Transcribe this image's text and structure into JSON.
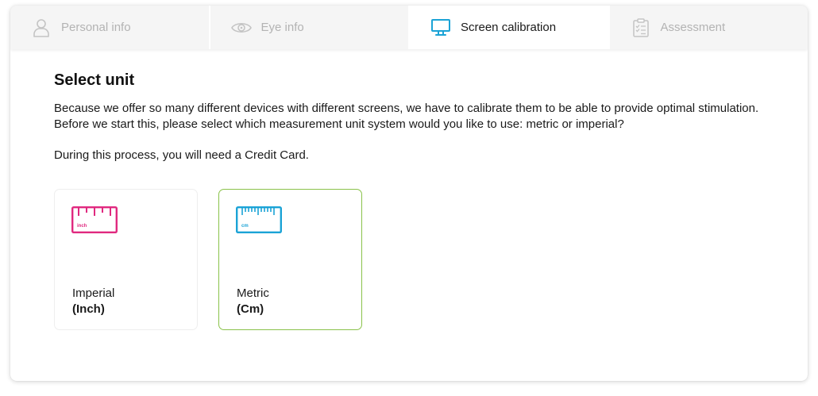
{
  "steps": [
    {
      "label": "Personal info",
      "icon": "person-icon",
      "state": "inactive"
    },
    {
      "label": "Eye info",
      "icon": "eye-icon",
      "state": "inactive"
    },
    {
      "label": "Screen calibration",
      "icon": "monitor-icon",
      "state": "active"
    },
    {
      "label": "Assessment",
      "icon": "clipboard-icon",
      "state": "inactive"
    }
  ],
  "main": {
    "title": "Select unit",
    "description": "Because we offer so many different devices with different screens, we have to calibrate them to be able to provide optimal stimulation. Before we start this, please select which measurement unit system would you like to use: metric or imperial?",
    "note": "During this process, you will need a Credit Card."
  },
  "options": [
    {
      "name": "Imperial",
      "unit": "(Inch)",
      "ruler_label": "inch",
      "color": "#e0297f",
      "selected": false
    },
    {
      "name": "Metric",
      "unit": "(Cm)",
      "ruler_label": "cm",
      "color": "#1ba3d6",
      "selected": true
    }
  ],
  "colors": {
    "active_step_icon": "#1ba3d6",
    "inactive_text": "#b3b3b3",
    "selected_border": "#8ac24a"
  }
}
